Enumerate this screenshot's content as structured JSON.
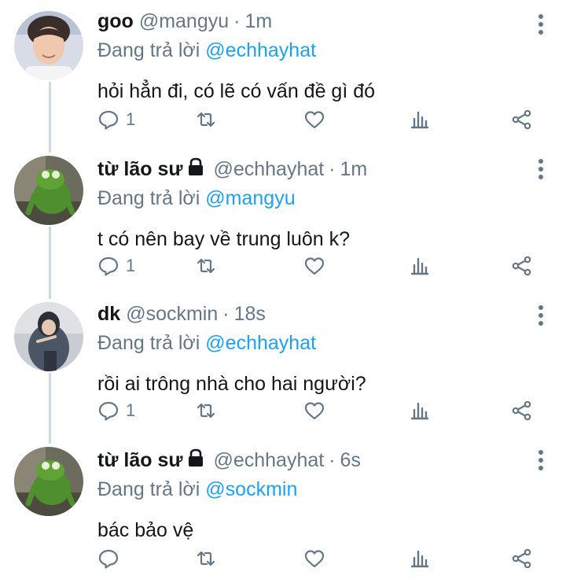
{
  "colors": {
    "link": "#1da1f2",
    "muted": "#657786",
    "text": "#14171a",
    "thread": "#cfd9de"
  },
  "tweets": [
    {
      "name": "goo",
      "handle": "@mangyu",
      "time": "1m",
      "locked": false,
      "reply_prefix": "Đang trả lời",
      "reply_to": "@echhayhat",
      "text": "hỏi hẳn đi, có lẽ có vấn đề gì đó",
      "reply_count": "1",
      "avatar_icon": "person-photo"
    },
    {
      "name": "từ lão sư",
      "handle": "@echhayhat",
      "time": "1m",
      "locked": true,
      "reply_prefix": "Đang trả lời",
      "reply_to": "@mangyu",
      "text": "t có nên bay về trung luôn k?",
      "reply_count": "1",
      "avatar_icon": "frog-photo"
    },
    {
      "name": "dk",
      "handle": "@sockmin",
      "time": "18s",
      "locked": false,
      "reply_prefix": "Đang trả lời",
      "reply_to": "@echhayhat",
      "text": "rồi ai trông nhà cho hai người?",
      "reply_count": "1",
      "avatar_icon": "person-photo"
    },
    {
      "name": "từ lão sư",
      "handle": "@echhayhat",
      "time": "6s",
      "locked": true,
      "reply_prefix": "Đang trả lời",
      "reply_to": "@sockmin",
      "text": "bác bảo vệ",
      "reply_count": "",
      "avatar_icon": "frog-photo"
    }
  ],
  "separator": "·"
}
